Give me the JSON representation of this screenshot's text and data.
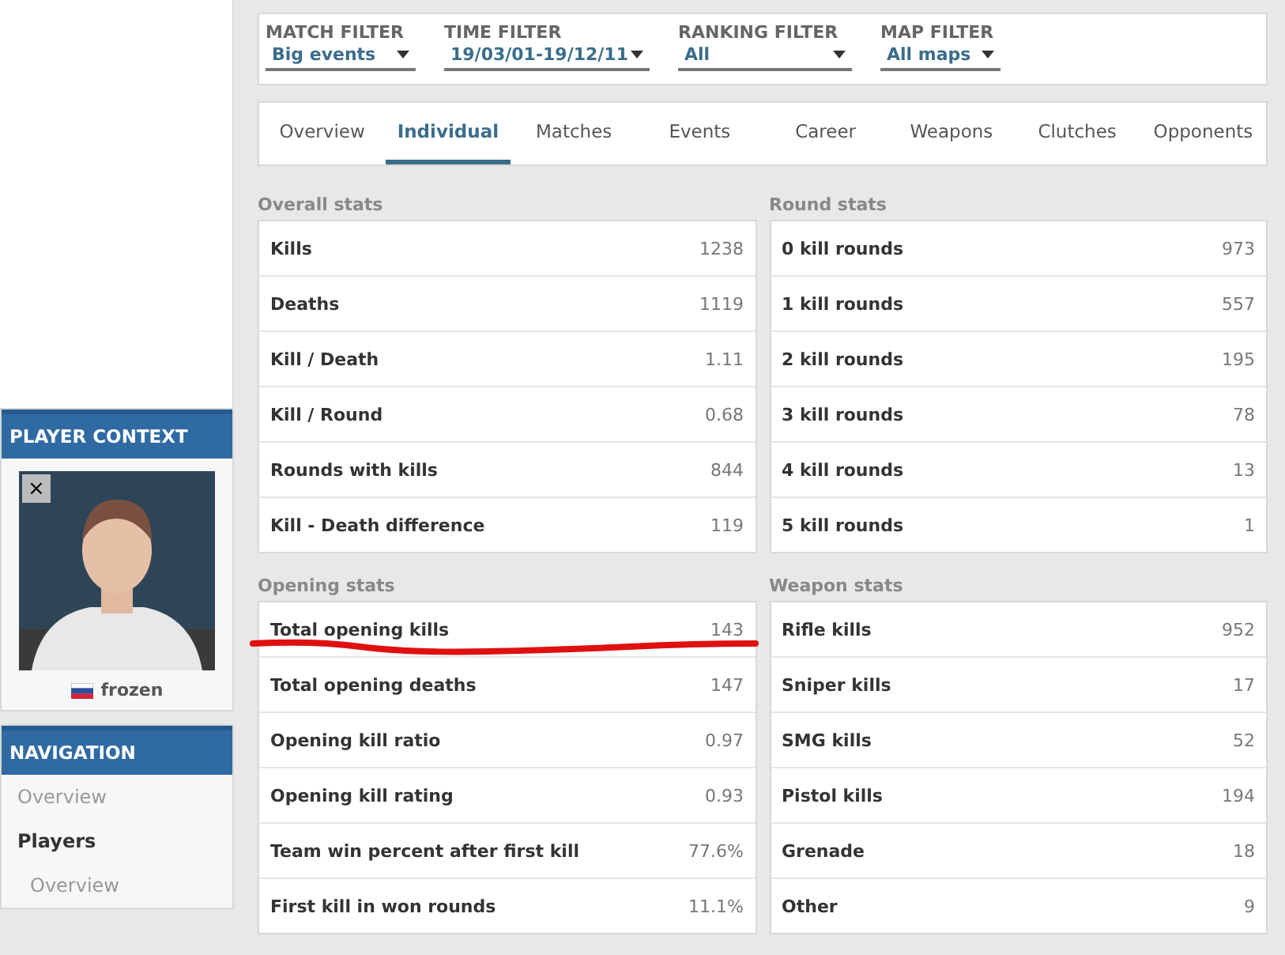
{
  "filters": [
    {
      "label": "MATCH FILTER",
      "value": "Big events"
    },
    {
      "label": "TIME FILTER",
      "value": "19/03/01-19/12/11"
    },
    {
      "label": "RANKING FILTER",
      "value": "All"
    },
    {
      "label": "MAP FILTER",
      "value": "All maps"
    }
  ],
  "tabs": [
    {
      "label": "Overview",
      "selected": false
    },
    {
      "label": "Individual",
      "selected": true
    },
    {
      "label": "Matches",
      "selected": false
    },
    {
      "label": "Events",
      "selected": false
    },
    {
      "label": "Career",
      "selected": false
    },
    {
      "label": "Weapons",
      "selected": false
    },
    {
      "label": "Clutches",
      "selected": false
    },
    {
      "label": "Opponents",
      "selected": false
    }
  ],
  "sections": [
    {
      "title": "Overall stats",
      "rows": [
        {
          "label": "Kills",
          "value": "1238"
        },
        {
          "label": "Deaths",
          "value": "1119"
        },
        {
          "label": "Kill / Death",
          "value": "1.11"
        },
        {
          "label": "Kill / Round",
          "value": "0.68"
        },
        {
          "label": "Rounds with kills",
          "value": "844"
        },
        {
          "label": "Kill - Death difference",
          "value": "119"
        }
      ]
    },
    {
      "title": "Round stats",
      "rows": [
        {
          "label": "0 kill rounds",
          "value": "973"
        },
        {
          "label": "1 kill rounds",
          "value": "557"
        },
        {
          "label": "2 kill rounds",
          "value": "195"
        },
        {
          "label": "3 kill rounds",
          "value": "78"
        },
        {
          "label": "4 kill rounds",
          "value": "13"
        },
        {
          "label": "5 kill rounds",
          "value": "1"
        }
      ]
    },
    {
      "title": "Opening stats",
      "rows": [
        {
          "label": "Total opening kills",
          "value": "143",
          "underlined": true
        },
        {
          "label": "Total opening deaths",
          "value": "147"
        },
        {
          "label": "Opening kill ratio",
          "value": "0.97"
        },
        {
          "label": "Opening kill rating",
          "value": "0.93"
        },
        {
          "label": "Team win percent after first kill",
          "value": "77.6%"
        },
        {
          "label": "First kill in won rounds",
          "value": "11.1%"
        }
      ]
    },
    {
      "title": "Weapon stats",
      "rows": [
        {
          "label": "Rifle kills",
          "value": "952"
        },
        {
          "label": "Sniper kills",
          "value": "17"
        },
        {
          "label": "SMG kills",
          "value": "52"
        },
        {
          "label": "Pistol kills",
          "value": "194"
        },
        {
          "label": "Grenade",
          "value": "18"
        },
        {
          "label": "Other",
          "value": "9"
        }
      ]
    }
  ],
  "player_context": {
    "title": "PLAYER CONTEXT",
    "close": "×",
    "name": "frozen"
  },
  "navigation": {
    "title": "NAVIGATION",
    "items": [
      {
        "label": "Overview",
        "kind": "link"
      },
      {
        "label": "Players",
        "kind": "heading"
      },
      {
        "label": "Overview",
        "kind": "sublink"
      }
    ]
  }
}
